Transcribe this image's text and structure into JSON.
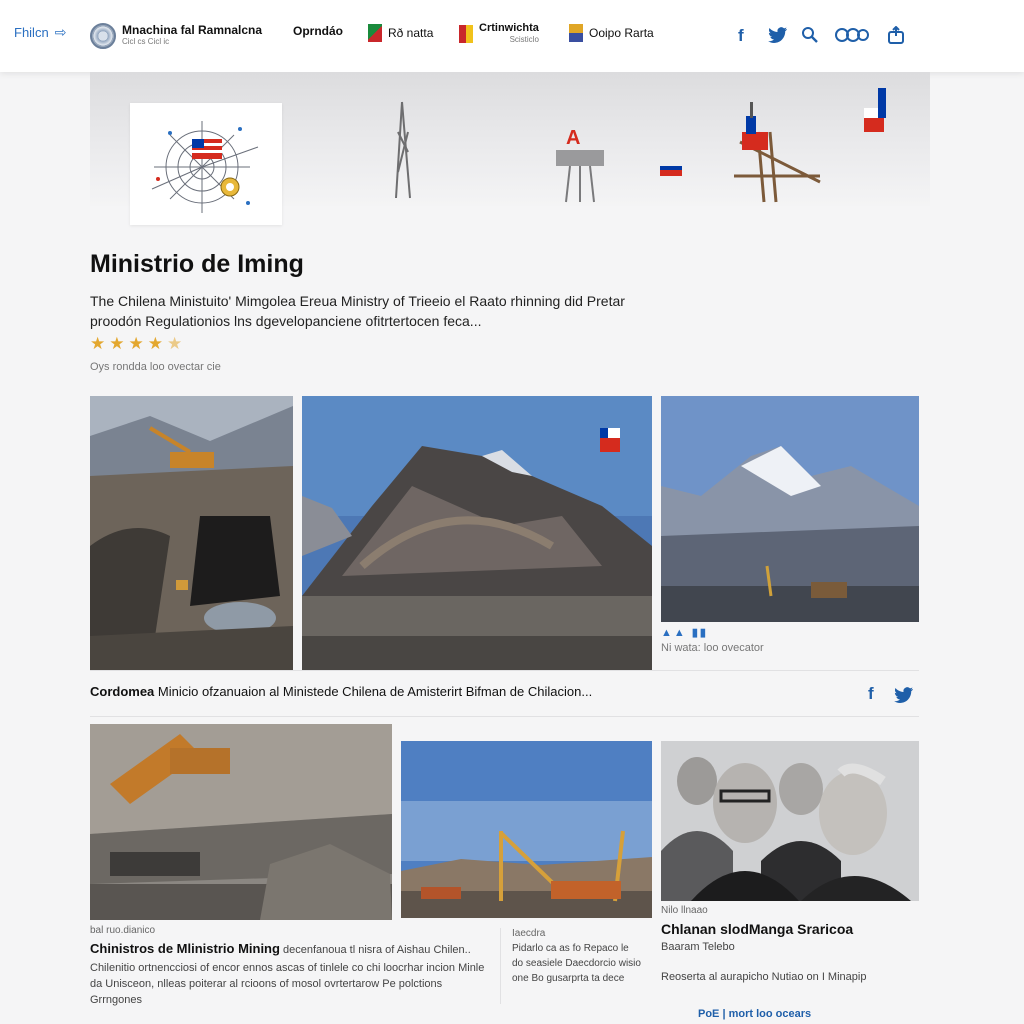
{
  "header": {
    "brand": "Fhilcn",
    "ministry_title": "Mnachina fal Ramnalcna",
    "ministry_subtitle": "Cicl cs Cicl ic",
    "nav": [
      "Oprndáo",
      "Rð natta",
      "Crtinwichta",
      "Ooipo Rarta"
    ],
    "nav_sub": "Scisticlo",
    "social": [
      "facebook",
      "twitter",
      "search",
      "links",
      "share"
    ]
  },
  "colors": {
    "accent": "#1f5fa9",
    "star": "#e3a72f",
    "flag_red": "#d52b1e",
    "flag_blue": "#0039a6"
  },
  "article": {
    "title": "Ministrio de Iming",
    "lead": "The Chilena Ministuito' Mimgolea Ereua Ministry of Trieeio el Raato rhinning did Pretar proodón Regulationios lns dgevelopanciene ofitrtertocen feca...",
    "rating_stars": 4.5,
    "rating_note": "Oys rondda loo ovectar cie"
  },
  "gallery": {
    "tags": "▲▲ ▮▮",
    "caption_right": "Ni wata: loo ovecator"
  },
  "strap": {
    "bold": "Cordomea",
    "text": " Minicio ofzanuaion al Ministede Chilena de Amisterirt Bifman de Chilacion..."
  },
  "cards": [
    {
      "kicker": "bal ruo.dianico",
      "title": "Chinistros de Mlinistrio Mining",
      "title_rest": " decenfanoua tl nisra of Aishau Chilen..",
      "body": "Chilenitio ortnencciosi of encor ennos ascas of tinlele co chi loocrhar incion Minle da Unisceon, nlleas poiterar al rcioons of mosol ovrtertarow Pe polctions Grrngones"
    },
    {
      "kicker": "Iaecdra",
      "title": "",
      "body": "Pidarlo ca as fo Repaco le do seasiele Daecdorcio wisio one Bo gusarprta ta dece"
    },
    {
      "kicker": "Nilo llnaao",
      "title": "Chlanan slodManga Sraricoa",
      "subtitle": "Baaram Telebo",
      "body": "Reoserta al aurapicho Nutiao on I Minapip"
    }
  ],
  "footer": {
    "link": "PoE  |  mort loo ocears"
  }
}
